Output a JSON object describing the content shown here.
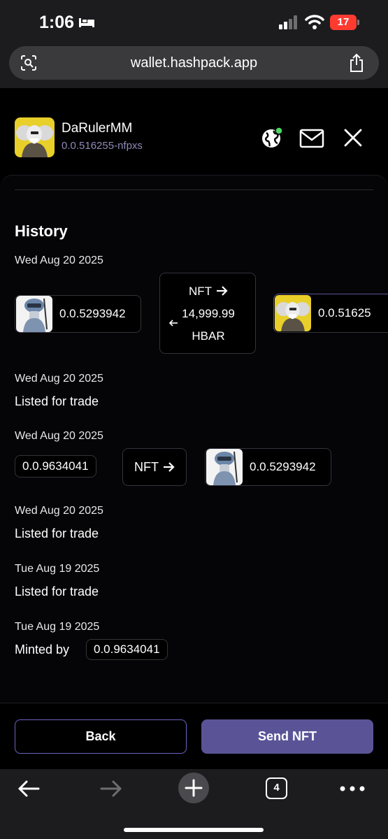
{
  "status_bar": {
    "time": "1:06",
    "battery": "17"
  },
  "browser": {
    "url": "wallet.hashpack.app",
    "tab_count": "4"
  },
  "account": {
    "name": "DaRulerMM",
    "id": "0.0.516255-nfpxs"
  },
  "history": {
    "title": "History",
    "events": [
      {
        "date": "Wed Aug 20 2025",
        "from_account": "0.0.5293942",
        "trade_line1": "NFT",
        "trade_line2": "14,999.99",
        "trade_line3": "HBAR",
        "to_account": "0.0.51625"
      },
      {
        "date": "Wed Aug 20 2025",
        "text": "Listed for trade"
      },
      {
        "date": "Wed Aug 20 2025",
        "from_account": "0.0.9634041",
        "transfer_label": "NFT",
        "to_account": "0.0.5293942"
      },
      {
        "date": "Wed Aug 20 2025",
        "text": "Listed for trade"
      },
      {
        "date": "Tue Aug 19 2025",
        "text": "Listed for trade"
      },
      {
        "date": "Tue Aug 19 2025",
        "text": "Minted by",
        "account": "0.0.9634041"
      }
    ]
  },
  "footer": {
    "back_label": "Back",
    "send_label": "Send NFT"
  },
  "colors": {
    "accent": "#5a5497",
    "accent_border": "#6b63c4",
    "muted_id": "#8e8ab8",
    "status_online": "#4cd964"
  },
  "icons": [
    "bed-icon",
    "signal-icon",
    "wifi-icon",
    "camera-search-icon",
    "share-icon",
    "globe-icon",
    "mail-icon",
    "close-icon",
    "arrow-right-icon",
    "arrow-left-icon",
    "nav-back-icon",
    "nav-forward-icon",
    "plus-icon",
    "more-icon"
  ]
}
